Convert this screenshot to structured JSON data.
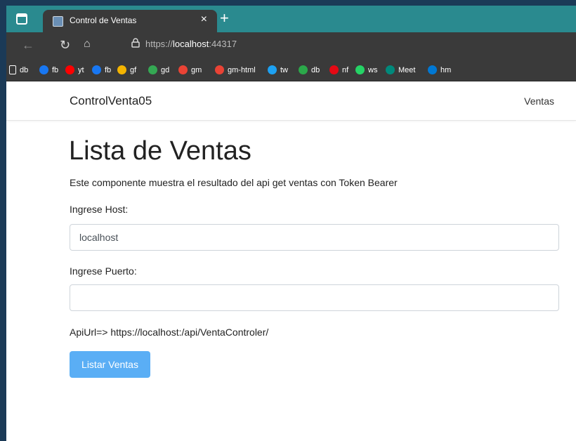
{
  "browser": {
    "tab_title": "Control de Ventas",
    "address_prefix": "https://",
    "address_host": "localhost",
    "address_port": ":44317",
    "bookmarks": [
      {
        "label": "db",
        "icon": "page-icon",
        "color": "#ffffff"
      },
      {
        "label": "fb",
        "icon": "facebook-icon",
        "color": "#1877f2"
      },
      {
        "label": "yt",
        "icon": "youtube-icon",
        "color": "#ff0000"
      },
      {
        "label": "fb",
        "icon": "facebook-icon",
        "color": "#1877f2"
      },
      {
        "label": "gf",
        "icon": "pinwheel-icon",
        "color": "#f4b400"
      },
      {
        "label": "gd",
        "icon": "google-drive-icon",
        "color": "#34a853"
      },
      {
        "label": "gm",
        "icon": "gmail-icon",
        "color": "#ea4335"
      },
      {
        "label": "gm-html",
        "icon": "gmail-icon",
        "color": "#ea4335"
      },
      {
        "label": "tw",
        "icon": "twitter-icon",
        "color": "#1da1f2"
      },
      {
        "label": "db",
        "icon": "db-icon",
        "color": "#2ba84a"
      },
      {
        "label": "nf",
        "icon": "netflix-icon",
        "color": "#e50914"
      },
      {
        "label": "ws",
        "icon": "whatsapp-icon",
        "color": "#25d366"
      },
      {
        "label": "Meet",
        "icon": "meet-icon",
        "color": "#00897b"
      },
      {
        "label": "hm",
        "icon": "outlook-icon",
        "color": "#0078d4"
      }
    ]
  },
  "app": {
    "brand": "ControlVenta05",
    "nav_link": "Ventas"
  },
  "main": {
    "title": "Lista de Ventas",
    "description": "Este componente muestra el resultado del api get ventas con Token Bearer",
    "host_label": "Ingrese Host:",
    "host_value": "localhost",
    "port_label": "Ingrese Puerto:",
    "port_value": "",
    "api_url": "ApiUrl=> https://localhost:/api/VentaControler/",
    "button_label": "Listar Ventas"
  },
  "colors": {
    "tab_bar": "#2a8a8f",
    "button": "#5aaef5"
  }
}
